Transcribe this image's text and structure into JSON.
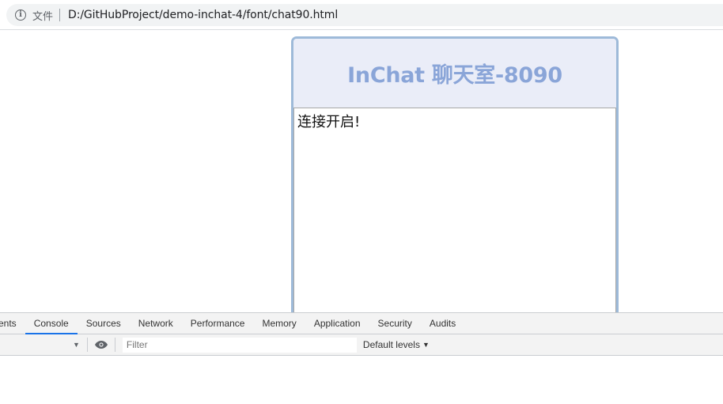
{
  "browser": {
    "security_chip": "文件",
    "url": "D:/GitHubProject/demo-inchat-4/font/chat90.html"
  },
  "chat": {
    "title": "InChat 聊天室-8090",
    "messages": [
      "连接开启!"
    ]
  },
  "devtools": {
    "tabs": [
      {
        "label": "ments"
      },
      {
        "label": "Console"
      },
      {
        "label": "Sources"
      },
      {
        "label": "Network"
      },
      {
        "label": "Performance"
      },
      {
        "label": "Memory"
      },
      {
        "label": "Application"
      },
      {
        "label": "Security"
      },
      {
        "label": "Audits"
      }
    ],
    "active_tab": "Console",
    "filter_placeholder": "Filter",
    "levels_label": "Default levels",
    "accent_color": "#1a73e8"
  }
}
